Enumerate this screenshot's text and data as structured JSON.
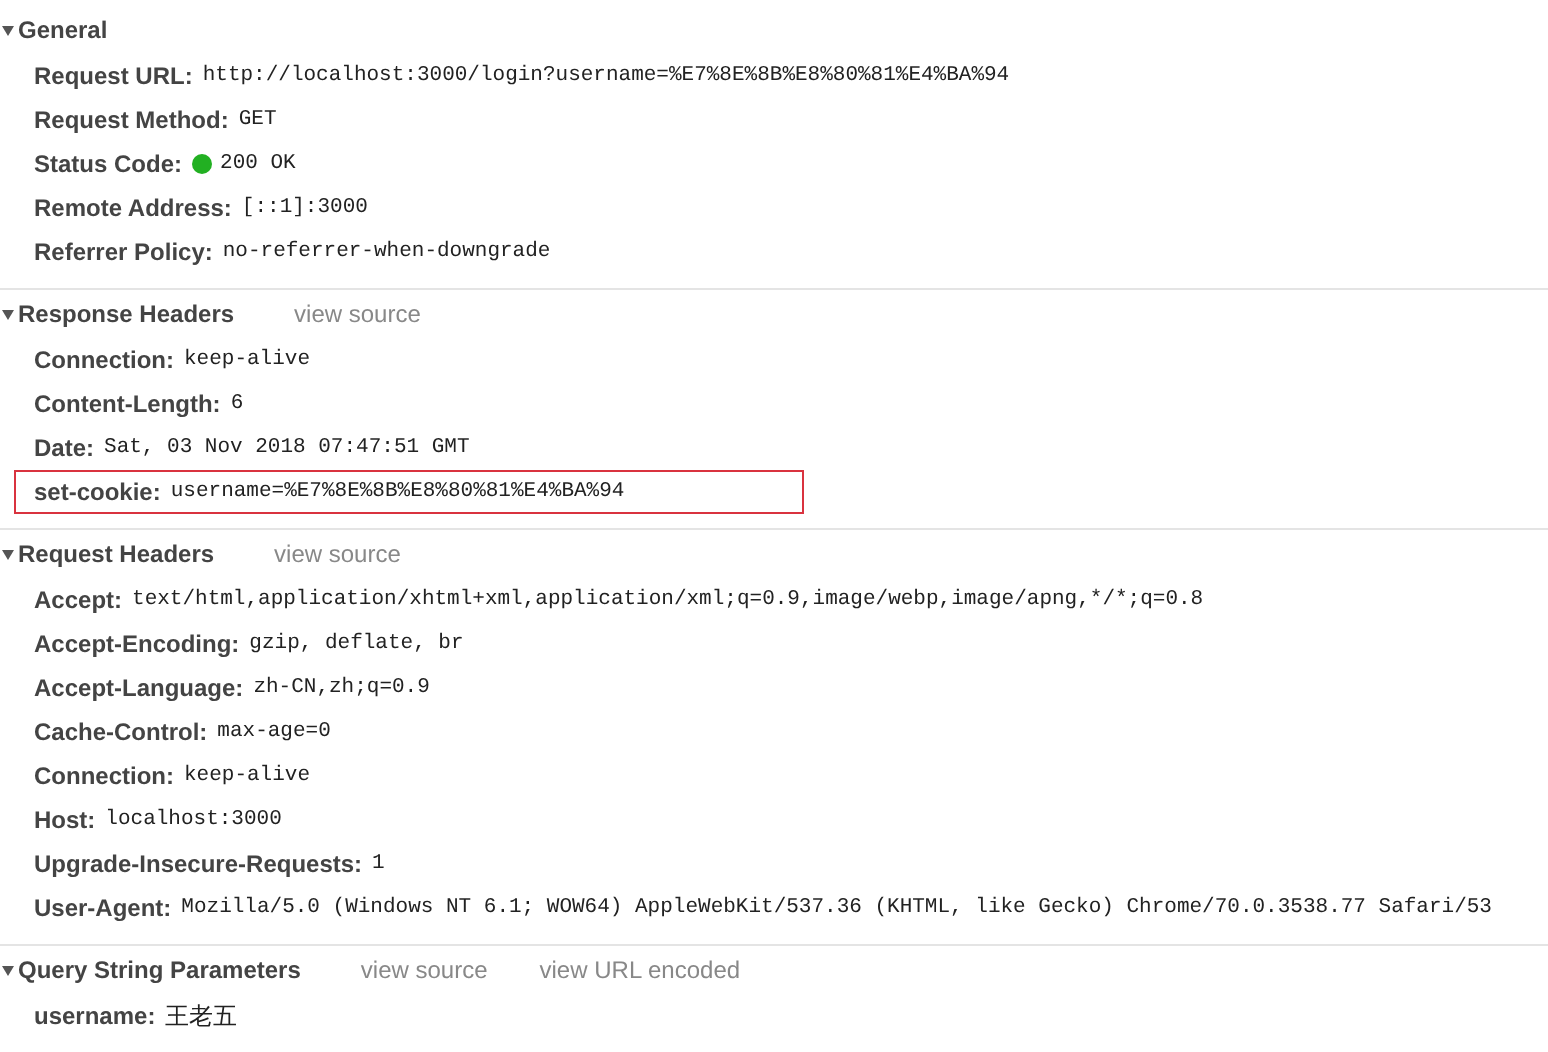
{
  "sections": [
    {
      "title": "General",
      "expanded": true,
      "rows": [
        {
          "kind": "plain",
          "name": "Request URL:",
          "value": "http://localhost:3000/login?username=%E7%8E%8B%E8%80%81%E4%BA%94",
          "highlighted": false
        },
        {
          "kind": "plain",
          "name": "Request Method:",
          "value": "GET",
          "highlighted": false
        },
        {
          "kind": "status",
          "name": "Status Code:",
          "value": "200 OK",
          "color": "#22b022",
          "highlighted": false
        },
        {
          "kind": "plain",
          "name": "Remote Address:",
          "value": "[::1]:3000",
          "highlighted": false
        },
        {
          "kind": "plain",
          "name": "Referrer Policy:",
          "value": "no-referrer-when-downgrade",
          "highlighted": false
        }
      ]
    },
    {
      "title": "Response Headers",
      "expanded": true,
      "links": [
        "view source"
      ],
      "rows": [
        {
          "kind": "plain",
          "name": "Connection:",
          "value": "keep-alive",
          "highlighted": false
        },
        {
          "kind": "plain",
          "name": "Content-Length:",
          "value": "6",
          "highlighted": false
        },
        {
          "kind": "plain",
          "name": "Date:",
          "value": "Sat, 03 Nov 2018 07:47:51 GMT",
          "highlighted": false
        },
        {
          "kind": "plain",
          "name": "set-cookie:",
          "value": "username=%E7%8E%8B%E8%80%81%E4%BA%94",
          "highlighted": true
        }
      ]
    },
    {
      "title": "Request Headers",
      "expanded": true,
      "links": [
        "view source"
      ],
      "rows": [
        {
          "kind": "plain",
          "name": "Accept:",
          "value": "text/html,application/xhtml+xml,application/xml;q=0.9,image/webp,image/apng,*/*;q=0.8",
          "highlighted": false
        },
        {
          "kind": "plain",
          "name": "Accept-Encoding:",
          "value": "gzip, deflate, br",
          "highlighted": false
        },
        {
          "kind": "plain",
          "name": "Accept-Language:",
          "value": "zh-CN,zh;q=0.9",
          "highlighted": false
        },
        {
          "kind": "plain",
          "name": "Cache-Control:",
          "value": "max-age=0",
          "highlighted": false
        },
        {
          "kind": "plain",
          "name": "Connection:",
          "value": "keep-alive",
          "highlighted": false
        },
        {
          "kind": "plain",
          "name": "Host:",
          "value": "localhost:3000",
          "highlighted": false
        },
        {
          "kind": "plain",
          "name": "Upgrade-Insecure-Requests:",
          "value": "1",
          "highlighted": false
        },
        {
          "kind": "plain",
          "name": "User-Agent:",
          "value": "Mozilla/5.0 (Windows NT 6.1; WOW64) AppleWebKit/537.36 (KHTML, like Gecko) Chrome/70.0.3538.77 Safari/53",
          "highlighted": false
        }
      ]
    },
    {
      "title": "Query String Parameters",
      "expanded": true,
      "links": [
        "view source",
        "view URL encoded"
      ],
      "rows": [
        {
          "kind": "param",
          "name": "username:",
          "value": "王老五",
          "highlighted": false
        }
      ]
    }
  ]
}
